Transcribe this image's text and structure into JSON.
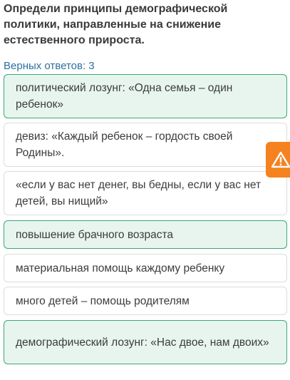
{
  "question": {
    "text": "Определи принципы демографической политики, направленные на снижение естественного прироста."
  },
  "answers_count": "Верных ответов: 3",
  "options": [
    {
      "label": "политический лозунг: «Одна семья – один ребенок»",
      "selected": true
    },
    {
      "label": "девиз: «Каждый ребенок – гордость своей Родины».",
      "selected": false
    },
    {
      "label": "«если у вас нет денег, вы бедны, если у вас нет детей, вы нищий»",
      "selected": false
    },
    {
      "label": "повышение брачного возраста",
      "selected": true
    },
    {
      "label": "материальная помощь каждому ребенку",
      "selected": false
    },
    {
      "label": "много детей – помощь родителям",
      "selected": false
    },
    {
      "label": "демографический лозунг: «Нас двое, нам двоих»",
      "selected": true
    }
  ],
  "colors": {
    "selected_bg": "#e8f5ef",
    "selected_border": "#3aa77a",
    "link_blue": "#2f6f9f",
    "warning_orange": "#f5821f"
  },
  "icons": {
    "report": "warning-icon"
  }
}
